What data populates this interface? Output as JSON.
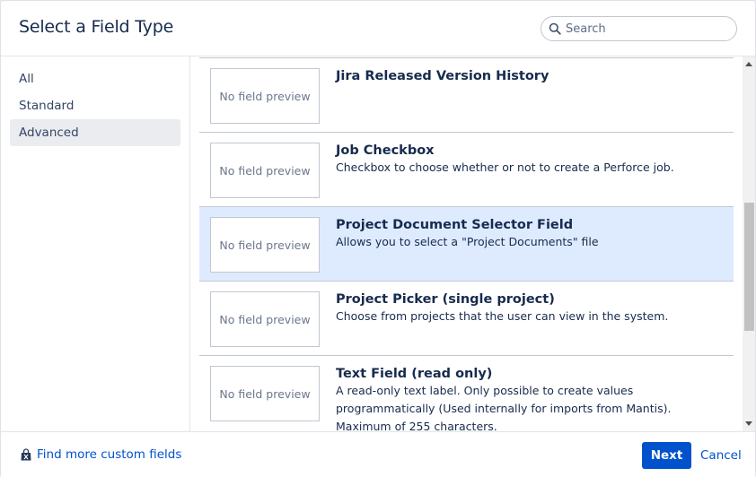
{
  "dialog": {
    "title": "Select a Field Type"
  },
  "search": {
    "placeholder": "Search",
    "value": "",
    "icon": "search-icon"
  },
  "sidebar": {
    "items": [
      {
        "label": "All",
        "active": false
      },
      {
        "label": "Standard",
        "active": false
      },
      {
        "label": "Advanced",
        "active": true
      }
    ]
  },
  "fields": [
    {
      "preview": "No field preview",
      "title": "Jira Released Version History",
      "description": "",
      "selected": false
    },
    {
      "preview": "No field preview",
      "title": "Job Checkbox",
      "description": "Checkbox to choose whether or not to create a Perforce job.",
      "selected": false
    },
    {
      "preview": "No field preview",
      "title": "Project Document Selector Field",
      "description": "Allows you to select a \"Project Documents\" file",
      "selected": true
    },
    {
      "preview": "No field preview",
      "title": "Project Picker (single project)",
      "description": "Choose from projects that the user can view in the system.",
      "selected": false
    },
    {
      "preview": "No field preview",
      "title": "Text Field (read only)",
      "description": "A read-only text label. Only possible to create values programmatically (Used internally for imports from Mantis). Maximum of 255 characters.",
      "selected": false
    }
  ],
  "footer": {
    "find_more_label": "Find more custom fields",
    "find_more_icon": "marketplace-bag-icon",
    "next_label": "Next",
    "cancel_label": "Cancel"
  },
  "colors": {
    "primary": "#0052cc",
    "selected_row": "#deebff",
    "text": "#172b4d"
  }
}
